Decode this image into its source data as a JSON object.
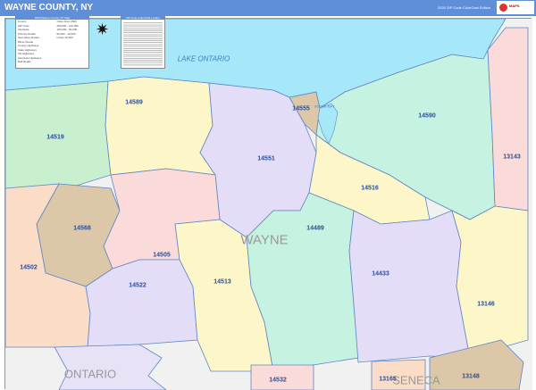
{
  "header": {
    "title": "WAYNE COUNTY, NY",
    "edition": "2020 ZIP Code ColorCast Edition",
    "logo_text": "MARKET MAPS"
  },
  "map": {
    "water": {
      "lake": "LAKE ONTARIO",
      "bay": "SODUS BAY"
    },
    "county_labels": {
      "wayne": "WAYNE",
      "ontario": "ONTARIO",
      "seneca": "SENECA"
    },
    "zip_labels": [
      "14519",
      "14589",
      "14555",
      "14590",
      "13143",
      "14551",
      "14516",
      "14568",
      "14505",
      "14502",
      "14489",
      "14522",
      "14513",
      "14433",
      "13146",
      "14532",
      "13165",
      "13148"
    ],
    "colors": {
      "lake": "#a6e8fa",
      "border": "#5d86c4",
      "title_bar": "#5f8fd8"
    }
  },
  "legend": {
    "title": "2020 Wayne County, NY Map",
    "items": [
      "County",
      "ZIP Code",
      "Interstate",
      "Primary Roads",
      "Secondary Roads",
      "Minor Roads",
      "County Highways",
      "State Highways",
      "US Highways",
      "Interstate Highways",
      "Rail Roads"
    ],
    "city_pop": [
      "Cities Over 250K",
      "250,000 - 100,000",
      "100,000 - 50,000",
      "50,000 - 10,000",
      "Under 10,000"
    ]
  },
  "locator": {
    "title": "ZIP Code Index/Grid Locator"
  },
  "compass": {
    "icon": "compass-rose-icon"
  }
}
